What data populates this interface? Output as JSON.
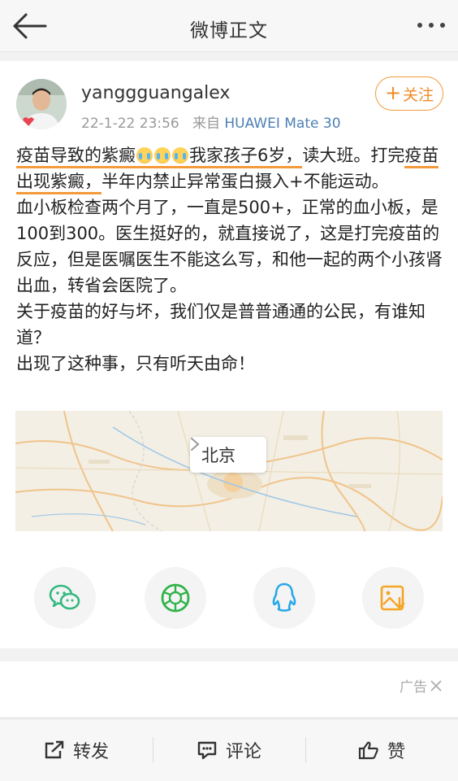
{
  "header": {
    "title": "微博正文"
  },
  "post": {
    "username": "yanggguangalex",
    "timestamp": "22-1-22 23:56",
    "source_prefix": "来自",
    "device": "HUAWEI Mate 30",
    "follow_label": "关注",
    "text": {
      "p1_a": "疫苗导致的紫癜",
      "p1_b": "我家孩子6岁，",
      "p1_c": "读大班。打完",
      "p1_d": "疫苗出现紫癜，",
      "p1_e": "半年内禁止异常蛋白摄入+不能运动。",
      "p2": "血小板检查两个月了，一直是500+，正常的血小板，是100到300。医生挺好的，就直接说了，这是打完疫苗的反应，但是医嘱医生不能这么写，和他一起的两个小孩肾出血，转省会医院了。",
      "p3": "关于疫苗的好与坏，我们仅是普普通通的公民，有谁知道？",
      "p4": "出现了这种事，只有听天由命！"
    },
    "location": "北京"
  },
  "share": {
    "items": [
      {
        "name": "wechat",
        "icon": "wechat-icon",
        "color": "#33b980"
      },
      {
        "name": "moments",
        "icon": "moments-icon",
        "color": "#2fb34a"
      },
      {
        "name": "qq",
        "icon": "qq-icon",
        "color": "#27a8e8"
      },
      {
        "name": "save-image",
        "icon": "save-image-icon",
        "color": "#f3a524"
      }
    ]
  },
  "ad": {
    "label": "广告"
  },
  "bottom": {
    "repost_label": "转发",
    "comment_label": "评论",
    "like_label": "赞"
  },
  "colors": {
    "accent": "#f39a3b",
    "link": "#4d7fb3"
  }
}
